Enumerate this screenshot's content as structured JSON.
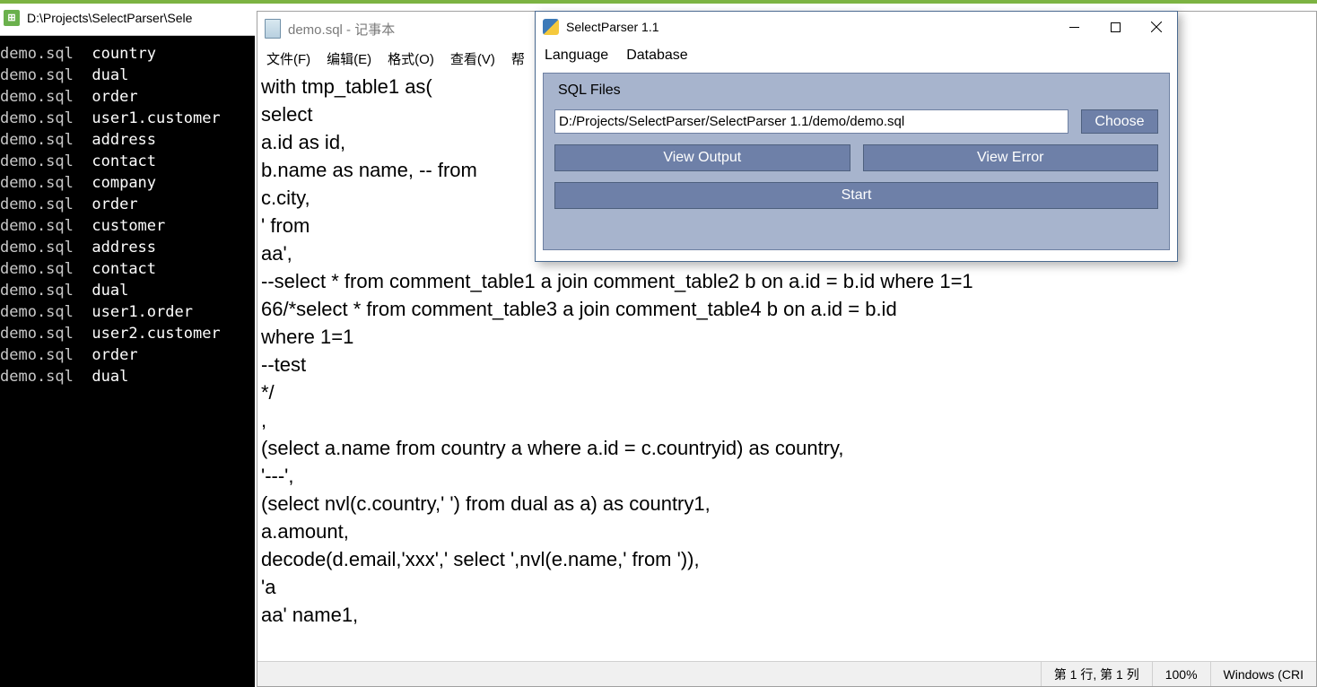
{
  "console": {
    "title": "D:\\Projects\\SelectParser\\Sele",
    "lines": [
      {
        "file": "demo.sql",
        "table": "country"
      },
      {
        "file": "demo.sql",
        "table": "dual"
      },
      {
        "file": "demo.sql",
        "table": "order"
      },
      {
        "file": "demo.sql",
        "table": "user1.customer"
      },
      {
        "file": "demo.sql",
        "table": "address"
      },
      {
        "file": "demo.sql",
        "table": "contact"
      },
      {
        "file": "demo.sql",
        "table": "company"
      },
      {
        "file": "demo.sql",
        "table": "order"
      },
      {
        "file": "demo.sql",
        "table": "customer"
      },
      {
        "file": "demo.sql",
        "table": "address"
      },
      {
        "file": "demo.sql",
        "table": "contact"
      },
      {
        "file": "demo.sql",
        "table": "dual"
      },
      {
        "file": "demo.sql",
        "table": "user1.order"
      },
      {
        "file": "demo.sql",
        "table": "user2.customer"
      },
      {
        "file": "demo.sql",
        "table": "order"
      },
      {
        "file": "demo.sql",
        "table": "dual"
      }
    ]
  },
  "notepad": {
    "title": "demo.sql - 记事本",
    "menu": {
      "file": "文件(F)",
      "edit": "编辑(E)",
      "format": "格式(O)",
      "view": "查看(V)",
      "help": "帮"
    },
    "content": "with tmp_table1 as(\nselect\na.id as id,\nb.name as name, -- from\nc.city,\n' from\naa',\n--select * from comment_table1 a join comment_table2 b on a.id = b.id where 1=1\n66/*select * from comment_table3 a join comment_table4 b on a.id = b.id\nwhere 1=1\n--test\n*/\n,\n(select a.name from country a where a.id = c.countryid) as country,\n'---',\n(select nvl(c.country,' ') from dual as a) as country1,\na.amount,\ndecode(d.email,'xxx',' select ',nvl(e.name,' from ')),\n'a\naa' name1,",
    "status": {
      "position": "第 1 行, 第 1 列",
      "zoom": "100%",
      "encoding": "Windows (CRI"
    }
  },
  "parser": {
    "title": "SelectParser 1.1",
    "menu": {
      "language": "Language",
      "database": "Database"
    },
    "section_label": "SQL Files",
    "path": "D:/Projects/SelectParser/SelectParser 1.1/demo/demo.sql",
    "buttons": {
      "choose": "Choose",
      "view_output": "View Output",
      "view_error": "View Error",
      "start": "Start"
    }
  }
}
